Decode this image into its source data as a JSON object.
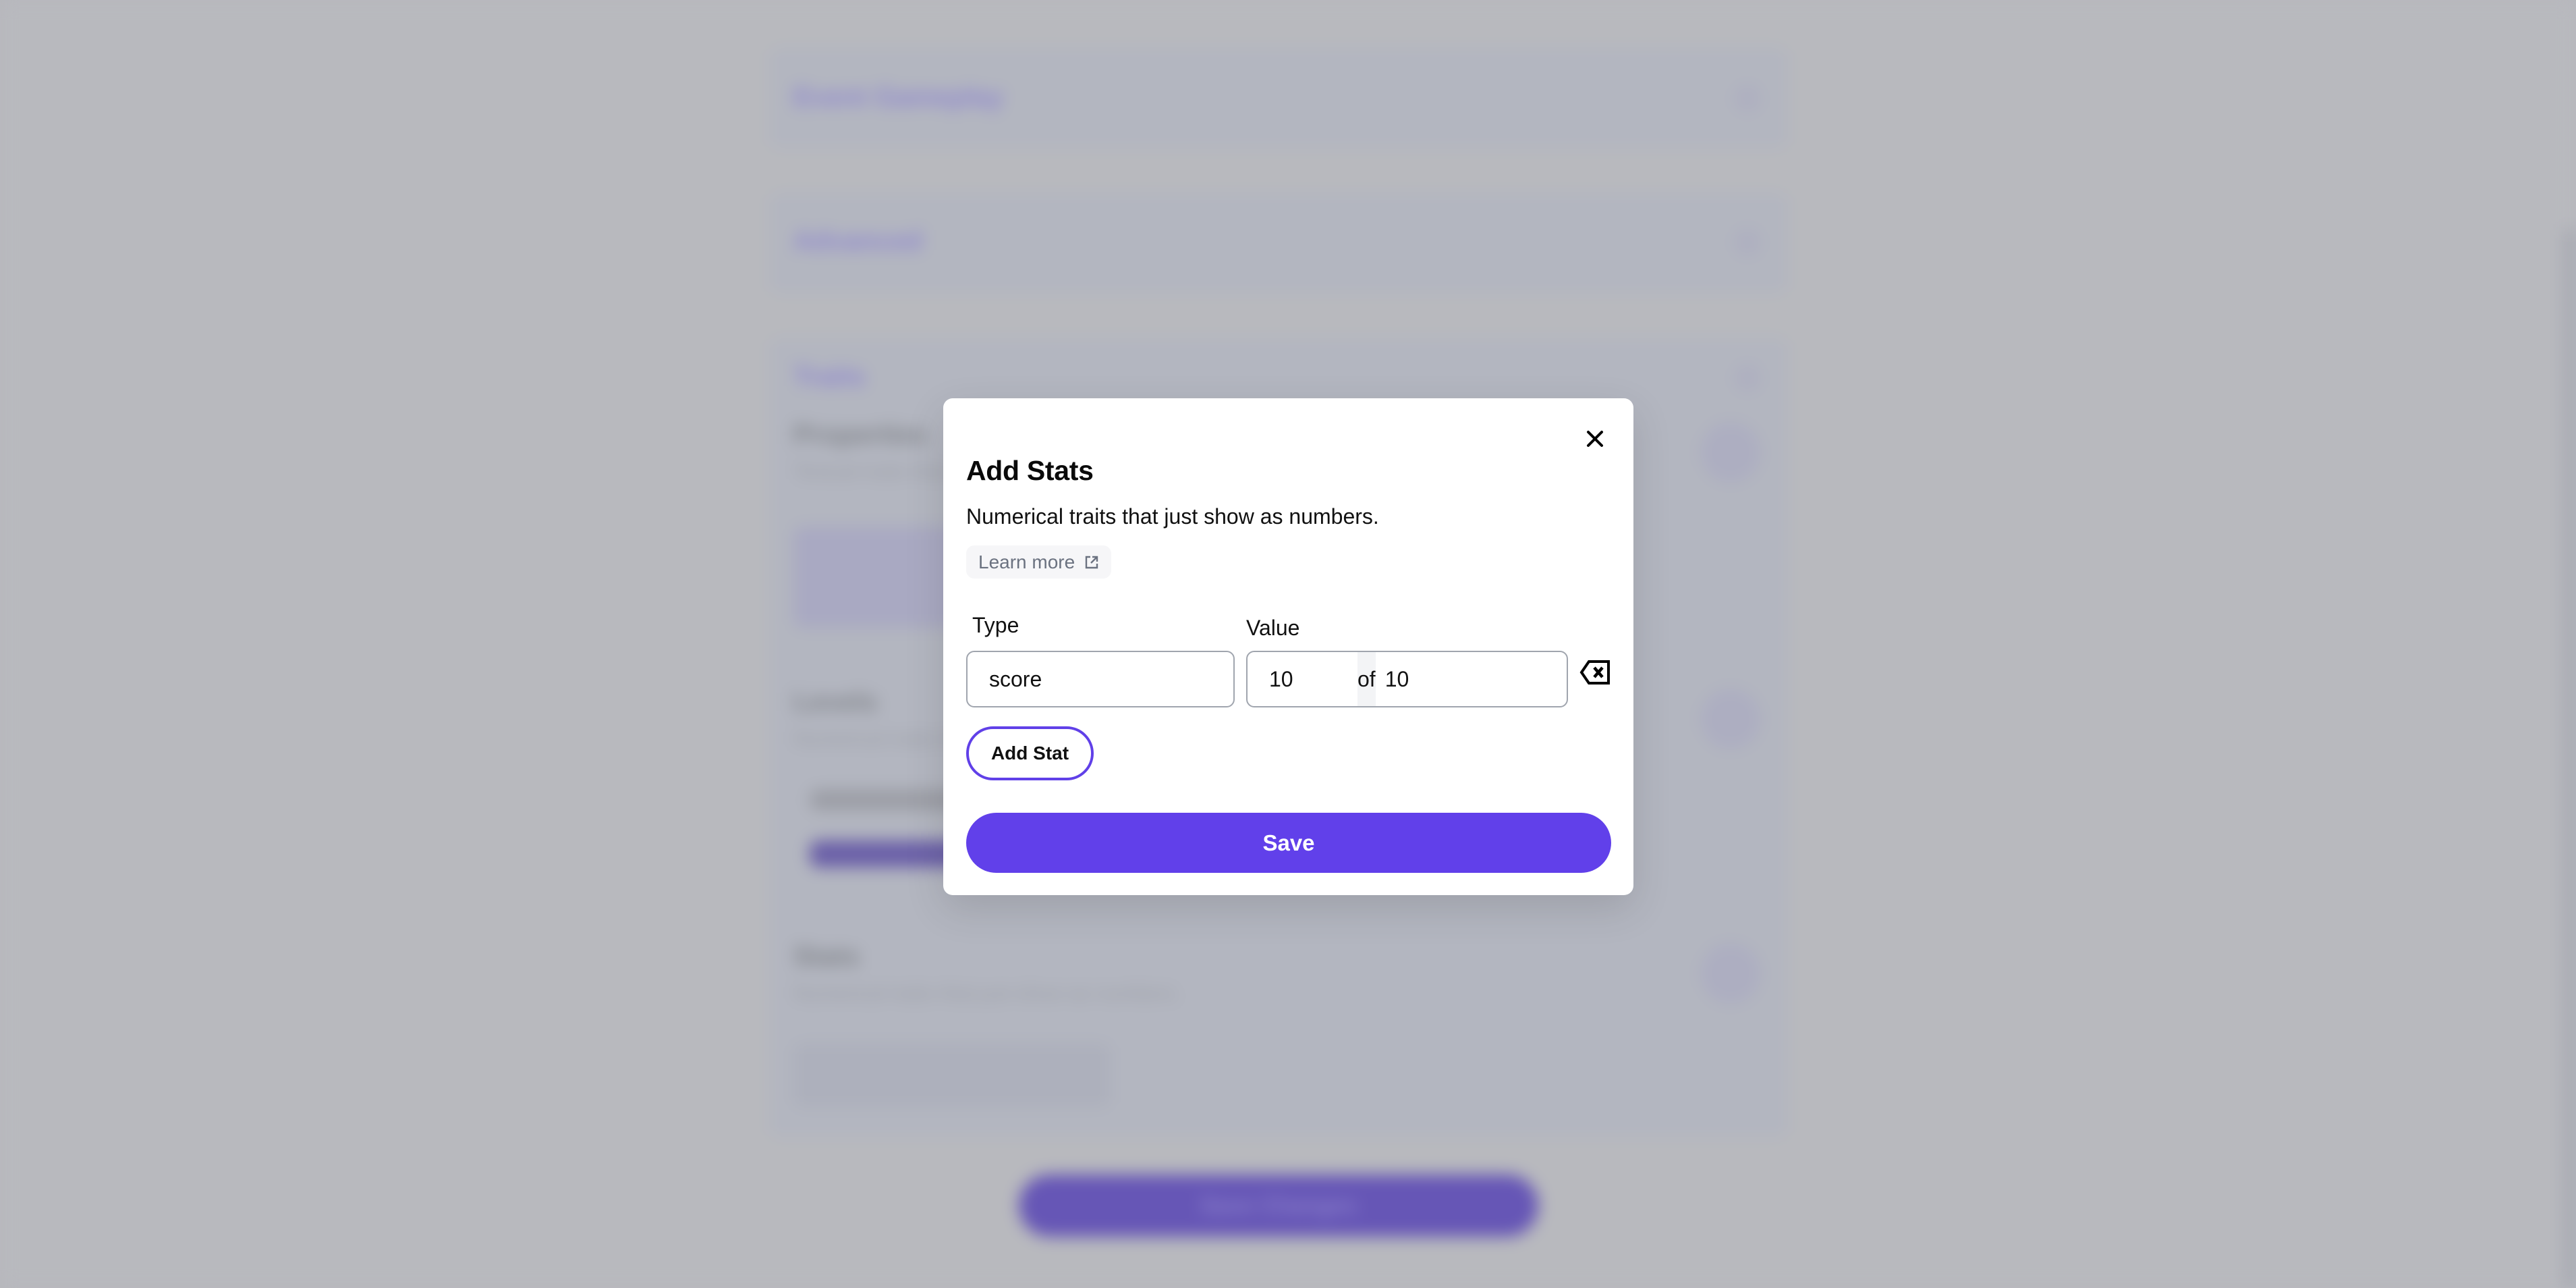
{
  "background": {
    "sections": [
      {
        "title": "Event Gameplay"
      },
      {
        "title": "Advanced"
      },
      {
        "title": "Traits"
      }
    ],
    "subsections": [
      {
        "title": "Properties",
        "description": "Textual traits that show up as rectangles."
      },
      {
        "title": "Levels",
        "description": "Numerical traits that show as a progress bar."
      },
      {
        "title": "Stats",
        "description": "Numerical traits that just show as numbers."
      }
    ],
    "cta_label": "Save Changes"
  },
  "modal": {
    "title": "Add Stats",
    "description": "Numerical traits that just show as numbers.",
    "learn_more_label": "Learn more",
    "type_label": "Type",
    "value_label": "Value",
    "stats": [
      {
        "type": "score",
        "value": "10",
        "max": "10"
      }
    ],
    "of_label": "of",
    "add_stat_label": "Add Stat",
    "save_label": "Save"
  },
  "colors": {
    "accent": "#6140ea",
    "overlay": "#b8b9be",
    "input_border": "#a0a5ae",
    "separator_bg": "#f3f4f6",
    "muted_text": "#6b7280"
  }
}
